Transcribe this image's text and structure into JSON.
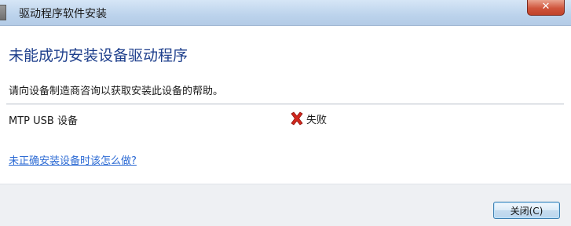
{
  "window": {
    "title": "驱动程序软件安装",
    "close_glyph": "✕"
  },
  "main": {
    "heading": "未能成功安装设备驱动程序",
    "instruction": "请向设备制造商咨询以获取安装此设备的帮助。",
    "device": {
      "name": "MTP USB 设备",
      "status": "失败",
      "status_icon": "red-x-icon",
      "status_color": "#d2281e"
    },
    "help_link": "未正确安装设备时该怎么做?"
  },
  "footer": {
    "close_button": "关闭(C)"
  },
  "colors": {
    "heading": "#1e3f8c",
    "link": "#2d6bd4",
    "footer_bg": "#eef0f3"
  }
}
